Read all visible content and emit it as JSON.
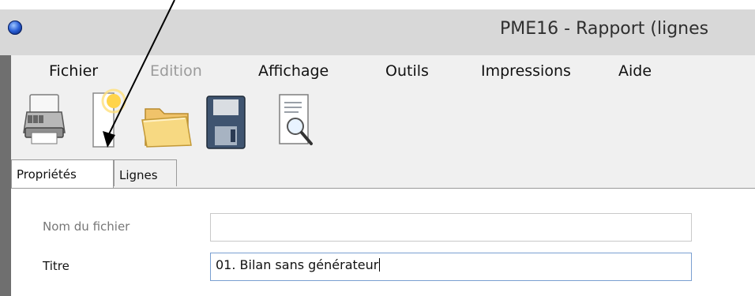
{
  "window": {
    "title": "PME16 - Rapport (lignes"
  },
  "menu": {
    "items": [
      {
        "label": "Fichier",
        "enabled": true
      },
      {
        "label": "Edition",
        "enabled": false
      },
      {
        "label": "Affichage",
        "enabled": true
      },
      {
        "label": "Outils",
        "enabled": true
      },
      {
        "label": "Impressions",
        "enabled": true
      },
      {
        "label": "Aide",
        "enabled": true
      }
    ]
  },
  "toolbar": {
    "buttons": [
      "printer-icon",
      "new-document-icon",
      "open-folder-icon",
      "save-floppy-icon",
      "print-preview-icon"
    ]
  },
  "tabs": [
    {
      "label": "Propriétés",
      "active": true
    },
    {
      "label": "Lignes",
      "active": false
    }
  ],
  "form": {
    "filename_label": "Nom du fichier",
    "filename_value": "",
    "title_label": "Titre",
    "title_value": "01. Bilan sans générateur"
  },
  "colors": {
    "titlebar": "#d8d8d8",
    "window_bg": "#f0f0f0",
    "focus_border": "#7a9fd1"
  }
}
